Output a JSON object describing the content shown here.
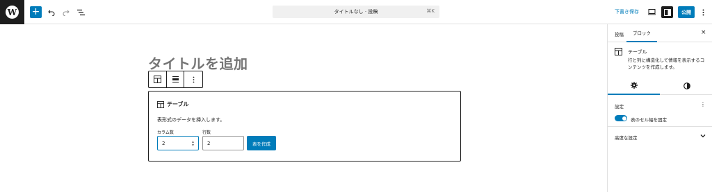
{
  "header": {
    "logo": "W",
    "add_icon": "+",
    "command_bar_text": "タイトルなし · 投稿",
    "command_shortcut": "⌘K",
    "save_draft_label": "下書き保存",
    "publish_label": "公開",
    "accent_color": "#007cba"
  },
  "editor": {
    "title_placeholder": "タイトルを追加",
    "table_placeholder": {
      "title": "テーブル",
      "instructions": "表形式のデータを挿入します。",
      "columns_label": "カラム数",
      "columns_value": "2",
      "rows_label": "行数",
      "rows_value": "2",
      "create_button_label": "表を作成"
    }
  },
  "sidebar": {
    "tabs": [
      {
        "label": "投稿"
      },
      {
        "label": "ブロック"
      }
    ],
    "close_icon": "×",
    "block_card": {
      "name": "テーブル",
      "description": "行と列に構造化して情報を表示するコンテンツを作成します。"
    },
    "settings": {
      "title": "設定",
      "more_icon": "⋮",
      "toggle_label": "表のセル幅を固定",
      "toggle_on": true
    },
    "advanced": {
      "title": "高度な設定"
    }
  }
}
